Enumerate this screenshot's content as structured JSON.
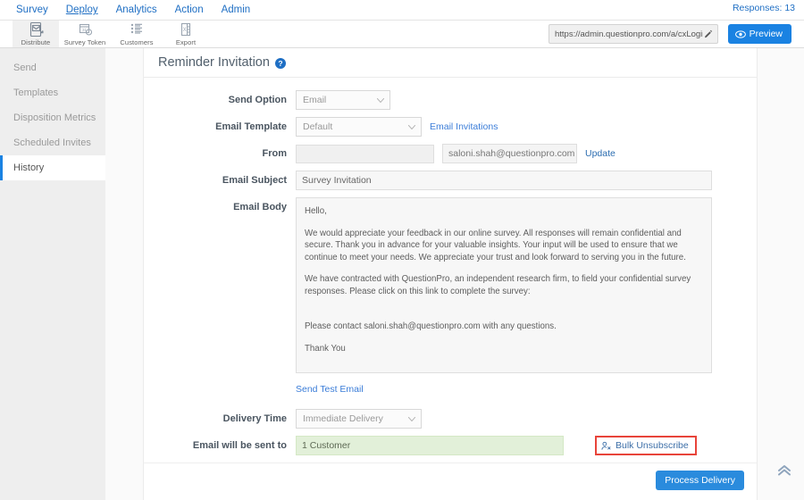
{
  "topnav": {
    "items": [
      {
        "label": "Survey",
        "active": false
      },
      {
        "label": "Deploy",
        "active": true
      },
      {
        "label": "Analytics",
        "active": false
      },
      {
        "label": "Action",
        "active": false
      },
      {
        "label": "Admin",
        "active": false
      }
    ],
    "responses": "Responses: 13"
  },
  "toolbar": {
    "items": [
      {
        "label": "Distribute",
        "icon": "distribute-icon",
        "active": true
      },
      {
        "label": "Survey Token",
        "icon": "survey-token-icon",
        "active": false
      },
      {
        "label": "Customers",
        "icon": "customers-icon",
        "active": false
      },
      {
        "label": "Export",
        "icon": "export-excel-icon",
        "active": false
      }
    ],
    "url_value": "https://admin.questionpro.com/a/cxLogin.do",
    "preview_label": "Preview"
  },
  "sidebar": {
    "items": [
      {
        "label": "Send",
        "active": false
      },
      {
        "label": "Templates",
        "active": false
      },
      {
        "label": "Disposition Metrics",
        "active": false
      },
      {
        "label": "Scheduled Invites",
        "active": false
      },
      {
        "label": "History",
        "active": true
      }
    ]
  },
  "page": {
    "title": "Reminder Invitation",
    "help_icon": "help-circle-icon"
  },
  "form": {
    "send_option_label": "Send Option",
    "send_option_value": "Email",
    "email_template_label": "Email Template",
    "email_template_value": "Default",
    "email_invitations_link": "Email Invitations",
    "from_label": "From",
    "from_value": "",
    "from_email": "saloni.shah@questionpro.com",
    "update_link": "Update",
    "email_subject_label": "Email Subject",
    "email_subject_value": "Survey Invitation",
    "email_body_label": "Email Body",
    "email_body": {
      "greeting": "Hello,",
      "para1": "We would appreciate your feedback in our online survey. All responses will remain confidential and secure. Thank you in advance for your valuable insights. Your input will be used to ensure that we continue to meet your needs. We appreciate your trust and look forward to serving you in the future.",
      "para2": "We have contracted with QuestionPro, an independent research firm, to field your confidential survey responses. Please click on this link to complete the survey:",
      "para3": "Please contact saloni.shah@questionpro.com with any questions.",
      "para4": "Thank You"
    },
    "send_test_email_link": "Send Test Email",
    "delivery_time_label": "Delivery Time",
    "delivery_time_value": "Immediate Delivery",
    "email_sent_to_label": "Email will be sent to",
    "email_sent_to_value": "1 Customer",
    "bulk_unsubscribe_label": "Bulk Unsubscribe",
    "bulk_unsubscribe_icon": "user-unsubscribe-icon"
  },
  "footer": {
    "process_delivery_label": "Process Delivery",
    "scroll_top_icon": "double-chevron-up-icon"
  },
  "colors": {
    "accent_blue": "#1a82e2",
    "link_blue": "#2b6cb0",
    "highlight_red": "#e8443a",
    "green_bg": "#e2f0d9"
  }
}
